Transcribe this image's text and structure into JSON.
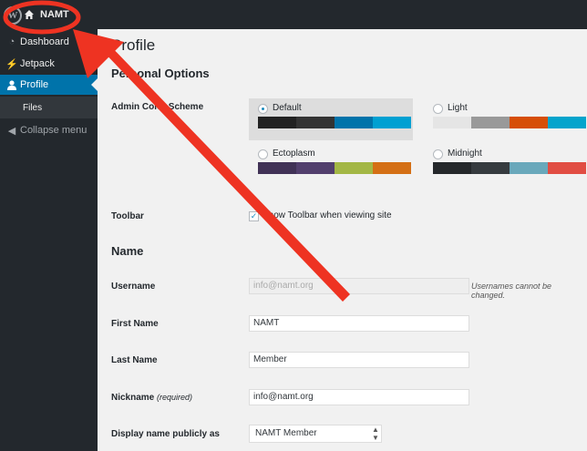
{
  "adminbar": {
    "wp_logo": "W",
    "site_name": "NAMT"
  },
  "sidebar": {
    "items": [
      {
        "label": "Dashboard",
        "icon": "dashboard-icon"
      },
      {
        "label": "Jetpack",
        "icon": "jetpack-icon"
      },
      {
        "label": "Profile",
        "icon": "user-icon"
      },
      {
        "label": "Files"
      },
      {
        "label": "Collapse menu",
        "icon": "collapse-icon"
      }
    ]
  },
  "profile": {
    "title": "Profile",
    "personal_options_heading": "Personal Options",
    "admin_color_scheme_label": "Admin Color Scheme",
    "schemes": [
      {
        "name": "Default",
        "selected": true,
        "colors": [
          "#222222",
          "#333333",
          "#0073aa",
          "#00a0d2"
        ]
      },
      {
        "name": "Light",
        "selected": false,
        "colors": [
          "#e5e5e5",
          "#999999",
          "#d64e07",
          "#04a4cc"
        ]
      },
      {
        "name": "Ectoplasm",
        "selected": false,
        "colors": [
          "#413256",
          "#523f6d",
          "#a3b745",
          "#d46f15"
        ]
      },
      {
        "name": "Midnight",
        "selected": false,
        "colors": [
          "#25282b",
          "#363b3f",
          "#69a8bb",
          "#e14d43"
        ]
      }
    ],
    "toolbar_label": "Toolbar",
    "toolbar_checkbox_label": "Show Toolbar when viewing site",
    "toolbar_checked": "✓",
    "name_heading": "Name",
    "username_label": "Username",
    "username_value": "info@namt.org",
    "username_note": "Usernames cannot be changed.",
    "first_name_label": "First Name",
    "first_name_value": "NAMT",
    "last_name_label": "Last Name",
    "last_name_value": "Member",
    "nickname_label": "Nickname",
    "nickname_required": "(required)",
    "nickname_value": "info@namt.org",
    "display_name_label": "Display name publicly as",
    "display_name_value": "NAMT Member"
  },
  "annotation_color": "#ee3322"
}
